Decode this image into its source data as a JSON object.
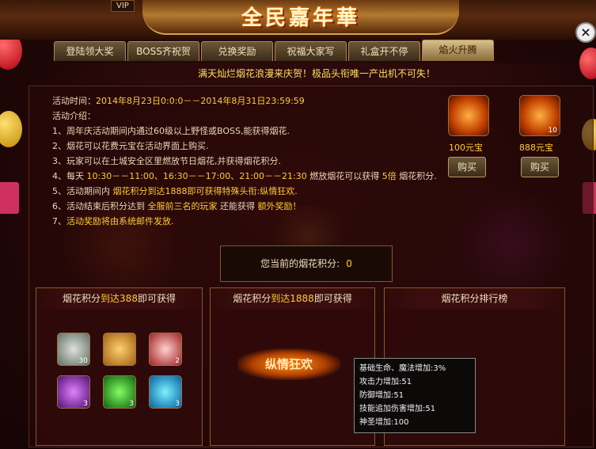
{
  "header": {
    "title": "全民嘉年華",
    "vip": "VIP"
  },
  "tabs": [
    "登陆领大奖",
    "BOSS齐祝贺",
    "兑换奖励",
    "祝福大家写",
    "礼盒开不停",
    "焰火升腾"
  ],
  "banner": "满天灿烂烟花浪漫来庆贺！极品头衔唯一产出机不可失！",
  "info": {
    "time_label": "活动时间：",
    "time_value": "2014年8月23日0:0:0－－2014年8月31日23:59:59",
    "intro_label": "活动介绍：",
    "rules": [
      "1、周年庆活动期间内通过60级以上野怪或BOSS,能获得烟花.",
      "2、烟花可以花费元宝在活动界面上购买.",
      "3、玩家可以在土城安全区里燃放节日烟花,并获得烟花积分."
    ],
    "rule4": {
      "a": "4、每天 ",
      "b": "10:30－－11:00、16:30－－17:00、21:00－－21:30",
      "c": " 燃放烟花可以获得 ",
      "d": "5倍",
      "e": " 烟花积分."
    },
    "rule5": {
      "a": "5、活动期间内 ",
      "b": "烟花积分到达1888即可获得特殊头衔:纵情狂欢."
    },
    "rule6": {
      "a": "6、活动结束后积分达到 ",
      "b": "全服前三名的玩家",
      "c": " 还能获得 ",
      "d": "额外奖励！"
    },
    "rule7": {
      "a": "7、",
      "b": "活动奖励将由系统邮件发放."
    }
  },
  "shop": [
    {
      "price": "100元宝",
      "button": "购买",
      "count": ""
    },
    {
      "price": "888元宝",
      "button": "购买",
      "count": "10"
    }
  ],
  "score": {
    "label": "您当前的烟花积分:",
    "value": "0"
  },
  "panels": [
    {
      "pre": "烟花积分",
      "hl": "到达388",
      "post": "即可获得",
      "items": [
        "30",
        "2",
        "3",
        "3",
        "3"
      ]
    },
    {
      "pre": "烟花积分",
      "hl": "到达1888",
      "post": "即可获得",
      "title_reward": "纵情狂欢"
    },
    {
      "title": "烟花积分排行榜"
    }
  ],
  "tooltip": [
    "基础生命、魔法增加:3%",
    "攻击力增加:51",
    "防御增加:51",
    "技能追加伤害增加:51",
    "神圣增加:100"
  ]
}
